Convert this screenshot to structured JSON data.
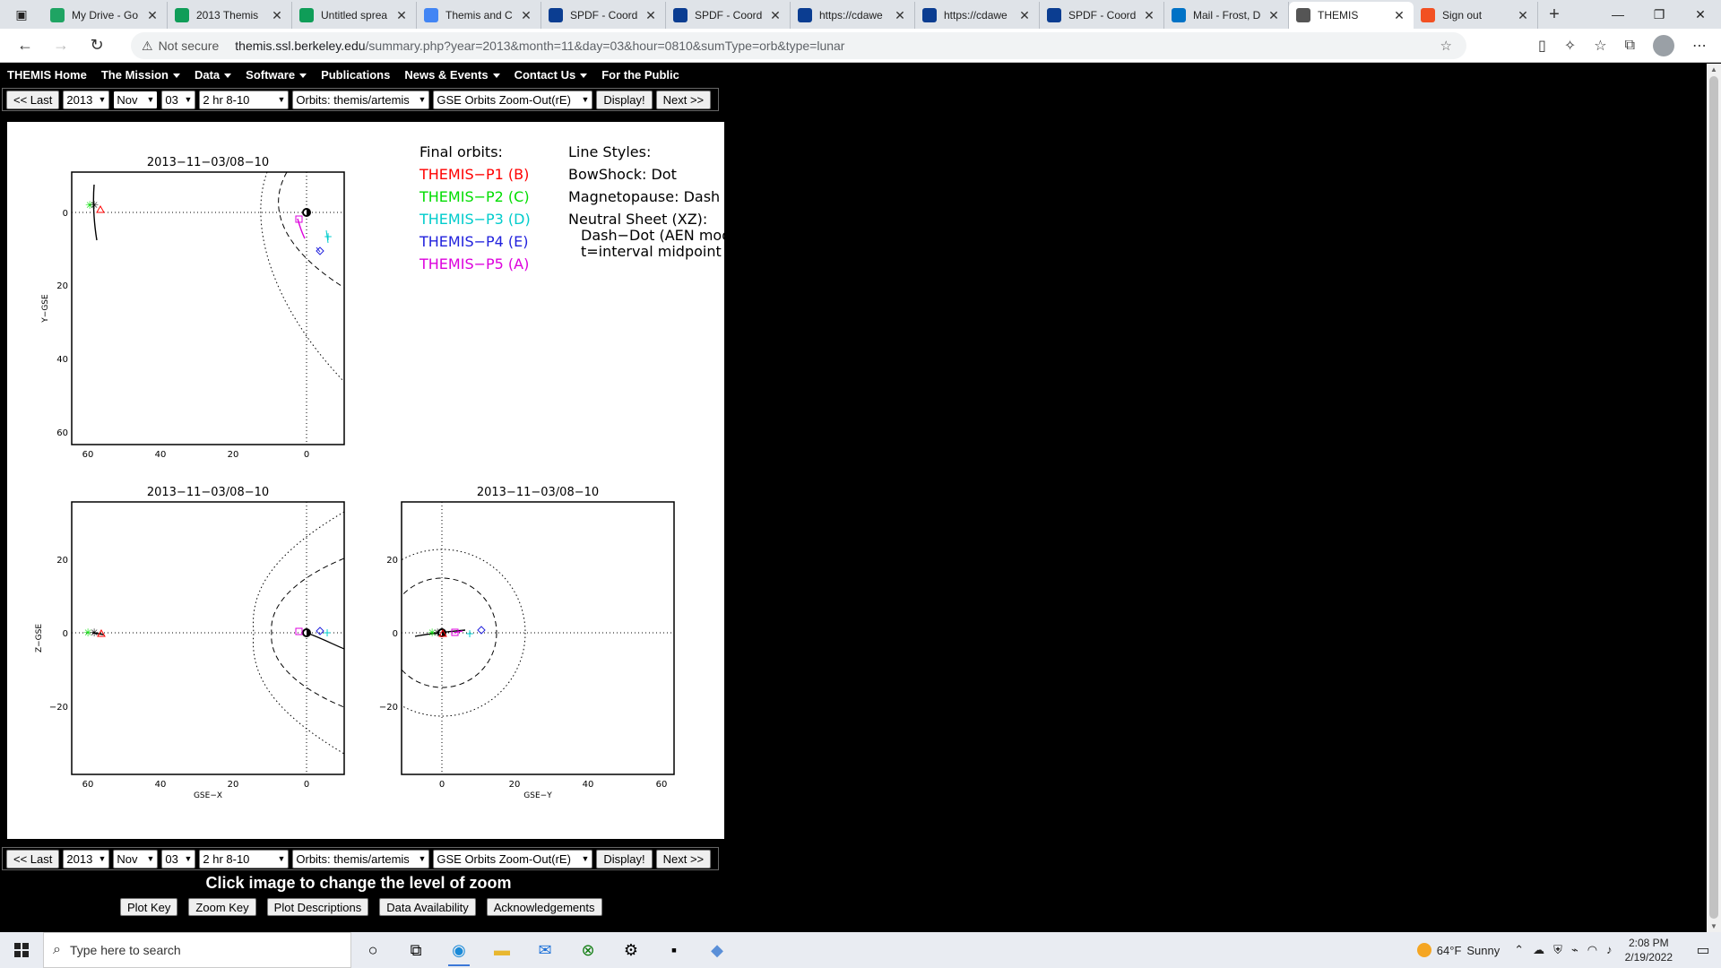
{
  "browser": {
    "tabs": [
      {
        "title": "My Drive - Go",
        "icon": "drive-icon",
        "color": "#1fa463"
      },
      {
        "title": "2013 Themis",
        "icon": "sheets-icon",
        "color": "#0f9d58"
      },
      {
        "title": "Untitled sprea",
        "icon": "sheets-icon",
        "color": "#0f9d58"
      },
      {
        "title": "Themis and C",
        "icon": "docs-icon",
        "color": "#4285f4"
      },
      {
        "title": "SPDF - Coord",
        "icon": "nasa-icon",
        "color": "#0b3d91"
      },
      {
        "title": "SPDF - Coord",
        "icon": "nasa-icon",
        "color": "#0b3d91"
      },
      {
        "title": "https://cdawe",
        "icon": "nasa-icon",
        "color": "#0b3d91"
      },
      {
        "title": "https://cdawe",
        "icon": "nasa-icon",
        "color": "#0b3d91"
      },
      {
        "title": "SPDF - Coord",
        "icon": "nasa-icon",
        "color": "#0b3d91"
      },
      {
        "title": "Mail - Frost, D",
        "icon": "outlook-icon",
        "color": "#0072c6"
      },
      {
        "title": "THEMIS",
        "icon": "themis-icon",
        "color": "#555555",
        "active": true
      },
      {
        "title": "Sign out",
        "icon": "microsoft-icon",
        "color": "#f25022"
      }
    ],
    "not_secure": "Not secure",
    "url_host": "themis.ssl.berkeley.edu",
    "url_rest": "/summary.php?year=2013&month=11&day=03&hour=0810&sumType=orb&type=lunar"
  },
  "menu": {
    "items": [
      {
        "label": "THEMIS Home",
        "caret": false
      },
      {
        "label": "The Mission",
        "caret": true
      },
      {
        "label": "Data",
        "caret": true
      },
      {
        "label": "Software",
        "caret": true
      },
      {
        "label": "Publications",
        "caret": false
      },
      {
        "label": "News & Events",
        "caret": true
      },
      {
        "label": "Contact Us",
        "caret": true
      },
      {
        "label": "For the Public",
        "caret": false
      }
    ]
  },
  "controls": {
    "last": "<< Last",
    "year": "2013",
    "month": "Nov",
    "day": "03",
    "interval": "2 hr 8-10",
    "orbits": "Orbits: themis/artemis",
    "zoom": "GSE Orbits Zoom-Out(rE)",
    "display": "Display!",
    "next": "Next >>"
  },
  "plot": {
    "legend": {
      "final_orbits": "Final orbits:",
      "probes": [
        {
          "label": "THEMIS−P1  (B)",
          "color": "#ff0000"
        },
        {
          "label": "THEMIS−P2  (C)",
          "color": "#00dd00"
        },
        {
          "label": "THEMIS−P3  (D)",
          "color": "#00cccc"
        },
        {
          "label": "THEMIS−P4  (E)",
          "color": "#2222dd"
        },
        {
          "label": "THEMIS−P5  (A)",
          "color": "#dd00dd"
        }
      ],
      "line_styles": "Line Styles:",
      "styles": [
        "BowShock: Dot",
        "Magnetopause: Dash",
        "Neutral Sheet (XZ):",
        "Dash−Dot (AEN mod)",
        "t=interval midpoint"
      ]
    },
    "panels": [
      {
        "title": "2013−11−03/08−10",
        "ylabel": "Y−GSE",
        "xlabel": "",
        "xticks": [
          "60",
          "40",
          "20",
          "0"
        ],
        "yticks": [
          "0",
          "20",
          "40",
          "60"
        ]
      },
      {
        "title": "2013−11−03/08−10",
        "ylabel": "Z−GSE",
        "xlabel": "GSE−X",
        "xticks": [
          "60",
          "40",
          "20",
          "0"
        ],
        "yticks": [
          "20",
          "0",
          "−20"
        ]
      },
      {
        "title": "2013−11−03/08−10",
        "ylabel": "",
        "xlabel": "GSE−Y",
        "xticks": [
          "0",
          "20",
          "40",
          "60"
        ],
        "yticks": [
          "20",
          "0",
          "−20"
        ]
      }
    ]
  },
  "footer": {
    "click_msg": "Click image to change the level of zoom",
    "buttons": [
      "Plot Key",
      "Zoom Key",
      "Plot Descriptions",
      "Data Availability",
      "Acknowledgements"
    ]
  },
  "taskbar": {
    "search_placeholder": "Type here to search",
    "weather_temp": "64°F",
    "weather_text": "Sunny",
    "time": "2:08 PM",
    "date": "2/19/2022"
  }
}
